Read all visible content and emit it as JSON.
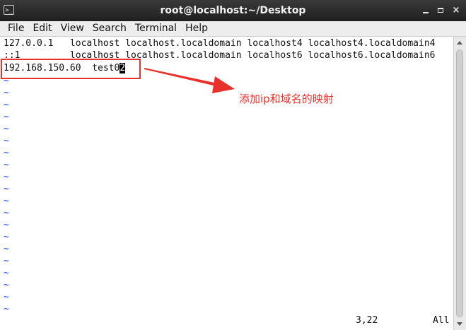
{
  "window": {
    "title": "root@localhost:~/Desktop",
    "icon": "terminal-icon",
    "controls": {
      "minimize": "minimize-icon",
      "maximize": "maximize-icon",
      "close": "×"
    }
  },
  "menu": [
    "File",
    "Edit",
    "View",
    "Search",
    "Terminal",
    "Help"
  ],
  "editor": {
    "lines": [
      "127.0.0.1   localhost localhost.localdomain localhost4 localhost4.localdomain4",
      "::1         localhost localhost.localdomain localhost6 localhost6.localdomain6"
    ],
    "edited_line_before_cursor": "192.168.150.60  test0",
    "cursor_char": "2",
    "tilde": "~",
    "status_position": "3,22",
    "status_scroll": "All"
  },
  "annotation": {
    "text": "添加ip和域名的映射",
    "color": "#e8302c"
  },
  "colors": {
    "titlebar": "#2a2a2a",
    "menubar": "#ededed",
    "tilde": "#1f4fd6"
  }
}
